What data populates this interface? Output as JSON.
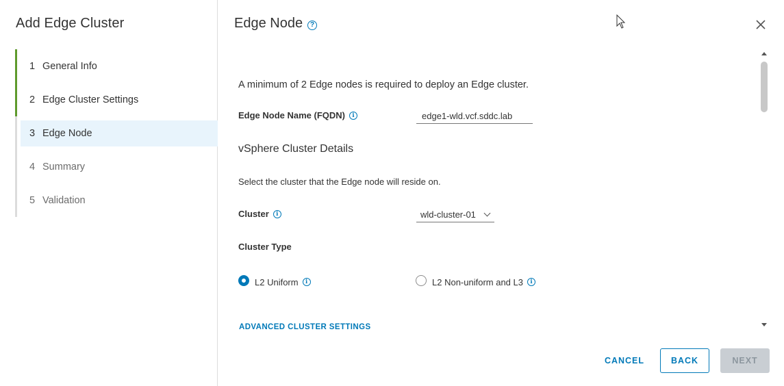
{
  "wizard": {
    "title": "Add Edge Cluster",
    "steps": [
      {
        "num": "1",
        "label": "General Info",
        "state": "done"
      },
      {
        "num": "2",
        "label": "Edge Cluster Settings",
        "state": "done"
      },
      {
        "num": "3",
        "label": "Edge Node",
        "state": "current"
      },
      {
        "num": "4",
        "label": "Summary",
        "state": "pending"
      },
      {
        "num": "5",
        "label": "Validation",
        "state": "pending"
      }
    ]
  },
  "page": {
    "title": "Edge Node",
    "help_icon": "question-circle-icon",
    "close_icon": "close-icon",
    "intro": "A minimum of 2 Edge nodes is required to deploy an Edge cluster.",
    "edge_node_name": {
      "label": "Edge Node Name (FQDN)",
      "value": "edge1-wld.vcf.sddc.lab"
    },
    "vsphere_section": {
      "title": "vSphere Cluster Details",
      "hint": "Select the cluster that the Edge node will reside on."
    },
    "cluster": {
      "label": "Cluster",
      "selected": "wld-cluster-01"
    },
    "cluster_type": {
      "label": "Cluster Type",
      "options": [
        {
          "label": "L2 Uniform",
          "checked": true
        },
        {
          "label": "L2 Non-uniform and L3",
          "checked": false
        }
      ]
    },
    "advanced_link": "ADVANCED CLUSTER SETTINGS"
  },
  "footer": {
    "cancel": "CANCEL",
    "back": "BACK",
    "next": "NEXT"
  },
  "colors": {
    "accent": "#0079b8",
    "step_done": "#5e9a2c",
    "step_current_bg": "#e8f4fc",
    "disabled_btn_bg": "#c9ced3"
  }
}
